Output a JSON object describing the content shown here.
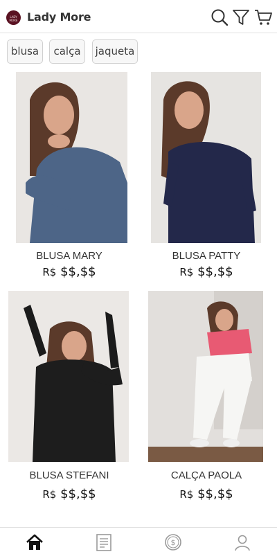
{
  "header": {
    "logo_text": "LADY MORE",
    "app_name": "Lady More"
  },
  "filters": [
    {
      "label": "blusa"
    },
    {
      "label": "calça"
    },
    {
      "label": "jaqueta"
    }
  ],
  "products": [
    {
      "name": "BLUSA MARY",
      "currency": "R$",
      "price": "$$,$$"
    },
    {
      "name": "BLUSA PATTY",
      "currency": "R$",
      "price": "$$,$$"
    },
    {
      "name": "BLUSA STEFANI",
      "currency": "R$",
      "price": "$$,$$"
    },
    {
      "name": "CALÇA PAOLA",
      "currency": "R$",
      "price": "$$,$$"
    }
  ],
  "nav": {
    "active": "home",
    "items": [
      "home-icon",
      "orders-icon",
      "wallet-icon",
      "profile-icon"
    ]
  },
  "colors": {
    "brand": "#5a1222",
    "active_nav": "#111111",
    "inactive_nav": "#9a9a9a"
  }
}
